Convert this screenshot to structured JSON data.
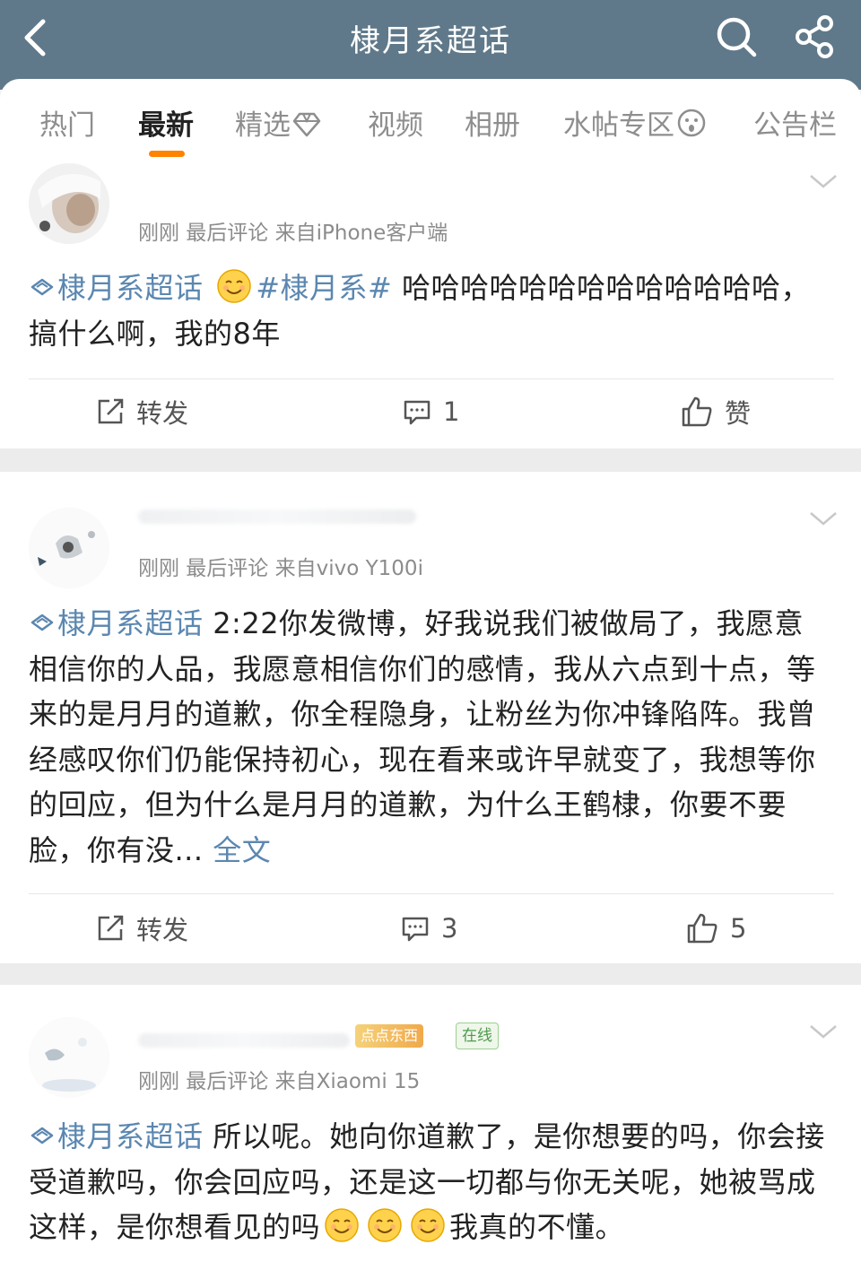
{
  "header": {
    "title": "棣月系超话",
    "back_icon": "chevron-left-icon",
    "search_icon": "search-icon",
    "share_icon": "share-icon"
  },
  "tabs": [
    {
      "label": "热门"
    },
    {
      "label": "最新",
      "active": true
    },
    {
      "label": "精选"
    },
    {
      "label": "视频"
    },
    {
      "label": "相册"
    },
    {
      "label": "水帖专区"
    },
    {
      "label": "公告栏"
    }
  ],
  "colors": {
    "header": "#60798a",
    "accent": "#ff8200",
    "link": "#5b87b0"
  },
  "posts": [
    {
      "meta": "刚刚 最后评论  来自iPhone客户端",
      "topic": "棣月系超话",
      "hashtag": "#棣月系#",
      "text": "哈哈哈哈哈哈哈哈哈哈哈哈哈，搞什么啊，我的8年",
      "repost_label": "转发",
      "comment_count": "1",
      "like_label": "赞"
    },
    {
      "meta": "刚刚 最后评论  来自vivo Y100i",
      "topic": "棣月系超话",
      "text": "2:22你发微博，好我说我们被做局了，我愿意相信你的人品，我愿意相信你们的感情，我从六点到十点，等来的是月月的道歉，你全程隐身，让粉丝为你冲锋陷阵。我曾经感叹你们仍能保持初心，现在看来或许早就变了，我想等你的回应，但为什么是月月的道歉，为什么王鹤棣，你要不要脸，你有没...",
      "more_label": "全文",
      "repost_label": "转发",
      "comment_count": "3",
      "like_count": "5"
    },
    {
      "meta": "刚刚 最后评论  来自Xiaomi 15",
      "badge_gold": "点点东西",
      "badge_online": "在线",
      "topic": "棣月系超话",
      "text": "所以呢。她向你道歉了，是你想要的吗，你会接受道歉吗，你会回应吗，还是这一切都与你无关呢，她被骂成这样，是你想看见的吗",
      "text_end": "我真的不懂。"
    }
  ]
}
